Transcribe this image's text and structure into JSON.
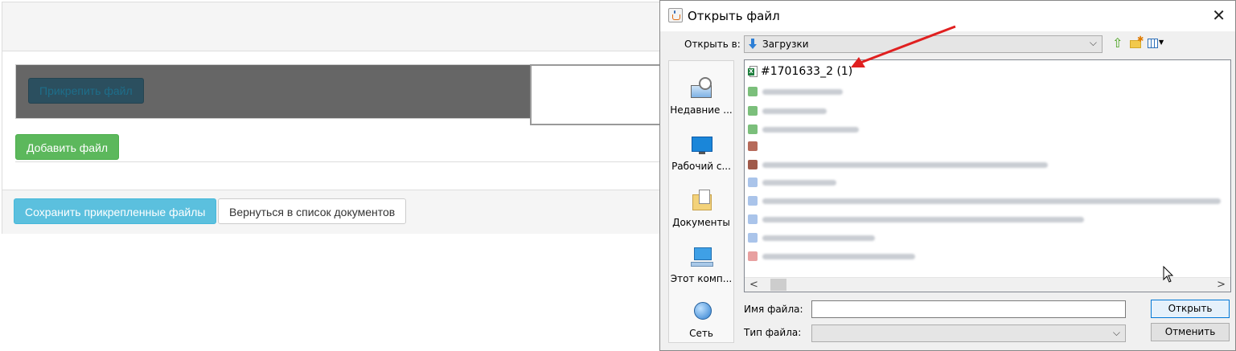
{
  "page": {
    "attach_button": "Прикрепить файл",
    "add_file_button": "Добавить файл",
    "save_button": "Сохранить прикрепленные файлы",
    "back_button": "Вернуться в список документов"
  },
  "dialog": {
    "title": "Открыть файл",
    "look_in_label": "Открыть в:",
    "look_in_value": "Загрузки",
    "places": [
      {
        "label": "Недавние ...",
        "icon": "recent-places-icon"
      },
      {
        "label": "Рабочий с...",
        "icon": "desktop-icon"
      },
      {
        "label": "Документы",
        "icon": "documents-icon"
      },
      {
        "label": "Этот комп...",
        "icon": "computer-icon"
      },
      {
        "label": "Сеть",
        "icon": "network-icon"
      }
    ],
    "files": [
      {
        "name": "#1701633_2 (1)",
        "icon": "excel-file-icon"
      }
    ],
    "file_name_label": "Имя файла:",
    "file_name_value": "",
    "file_type_label": "Тип файла:",
    "file_type_value": "",
    "open_button": "Открыть",
    "cancel_button": "Отменить"
  },
  "colors": {
    "attach_bg": "#2b4f5f",
    "add_bg": "#5cb85c",
    "save_bg": "#5bc0de",
    "annotation_arrow": "#e02020"
  }
}
